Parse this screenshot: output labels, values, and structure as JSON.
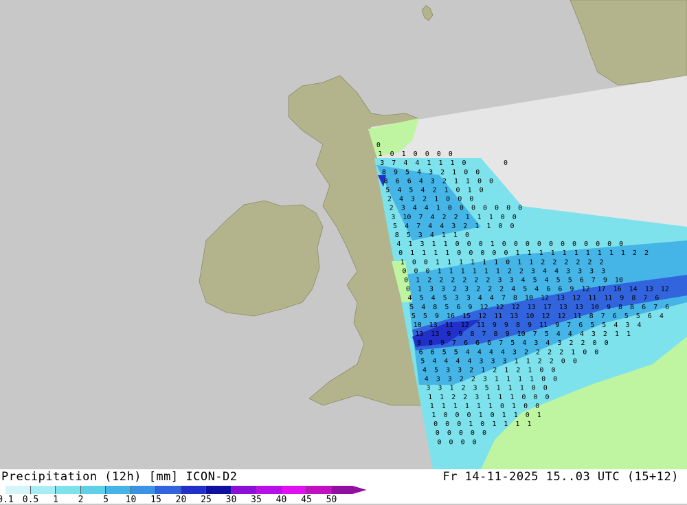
{
  "header": {
    "product": "Precipitation (12h) [mm] ICON-D2",
    "valid_time": "Fr 14-11-2025 15..03 UTC (15+12)"
  },
  "legend": {
    "ticks": [
      "0.1",
      "0.5",
      "1",
      "2",
      "5",
      "10",
      "15",
      "20",
      "25",
      "30",
      "35",
      "40",
      "45",
      "50"
    ],
    "colors": [
      "#d4f5fa",
      "#a8ecf4",
      "#7de2ec",
      "#5fd0e8",
      "#45b4e6",
      "#3c92e4",
      "#3264de",
      "#2030c8",
      "#1010a0",
      "#8a10d8",
      "#b810e8",
      "#e010f0",
      "#c010c0",
      "#9010a0"
    ]
  },
  "map": {
    "colors": {
      "sea": "#c8c8c8",
      "land": "#b4b48c",
      "model_domain": "#e6e6e6",
      "dry_land": "#bff5a0"
    },
    "values": [
      [
        "0"
      ],
      [
        "1 0 1 0 0 0 0"
      ],
      [
        "3 7 4 4 1 1 1 0",
        "0"
      ],
      [
        "8 9 5 4 3 2 1 0 0"
      ],
      [
        "8 6 6 4 3 2 1 1 0 0"
      ],
      [
        "5 4 5 4 2 1 0 1 0"
      ],
      [
        "2 4 3 2 1 0 0 0"
      ],
      [
        "2 3 4 4 1 0 0 0 0 0 0 0"
      ],
      [
        "3 10 7 4 2 2 1 1 1 0 0"
      ],
      [
        "5 4 7 4 4 3 2 1 1 0 0"
      ],
      [
        "8 5 3 4 1 1 0"
      ],
      [
        "4 1 3 1 1 0 0 0 1 0 0 0 0 0 0 0 0 0 0 0"
      ],
      [
        "0 1 1 1 1 0 0 0 0 0 1 1 1 1 1 1 1 1 1 1 2 2"
      ],
      [
        "1 0 0 1 1 1 1 1 1 0 1 1 2 2 2 2 2 2"
      ],
      [
        "0 0 0 1 1 1 1 1 1 2 2 3 4 4 3 3 3 3"
      ],
      [
        "0 1 2 2 2 2 2 2 3 3 4 5 4 5 5 6 7 9 10"
      ],
      [
        "0 1 3 3 2 3 2 2 2 4 5 4 6 6 9 12 17 16 14 13 12"
      ],
      [
        "4 5 4 5 3 3 4 4 7 8 10 12 13 12 11 11 9 8 7 6"
      ],
      [
        "5 4 8 5 6 9 12 12 12 13 17 13 13 10 9 8 8 6 7 6"
      ],
      [
        "5 5 9 16 15 12 11 13 10 12 12 11 8 7 6 5 5 6 4"
      ],
      [
        "10 13 11 12 11 9 9 8 9 11 9 7 6 5 5 4 3 4"
      ],
      [
        "13 13 9 9 8 7 8 9 10 7 5 4 4 4 3 2 1 1"
      ],
      [
        "9 8 9 7 6 6 6 7 5 4 3 4 3 2 2 0 0"
      ],
      [
        "6 6 5 5 4 4 4 4 3 2 2 2 2 1 0 0"
      ],
      [
        "5 4 4 4 4 3 3 3 1 1 2 2 0 0"
      ],
      [
        "4 5 3 3 2 1 2 1 2 1 0 0"
      ],
      [
        "4 3 3 2 2 3 1 1 1 1 0 0"
      ],
      [
        "3 3 1 2 3 5 1 1 1 0 0"
      ],
      [
        "1 1 2 2 3 1 1 1 0 0 0"
      ],
      [
        "1 1 1 1 1 1 0 1 0 0"
      ],
      [
        "1 0 0 0 1 0 1 1 0 1"
      ],
      [
        "0 0 0 1 0 1 1 1 1"
      ],
      [
        "0 0 0 0 0"
      ],
      [
        "0 0 0 0"
      ]
    ]
  }
}
